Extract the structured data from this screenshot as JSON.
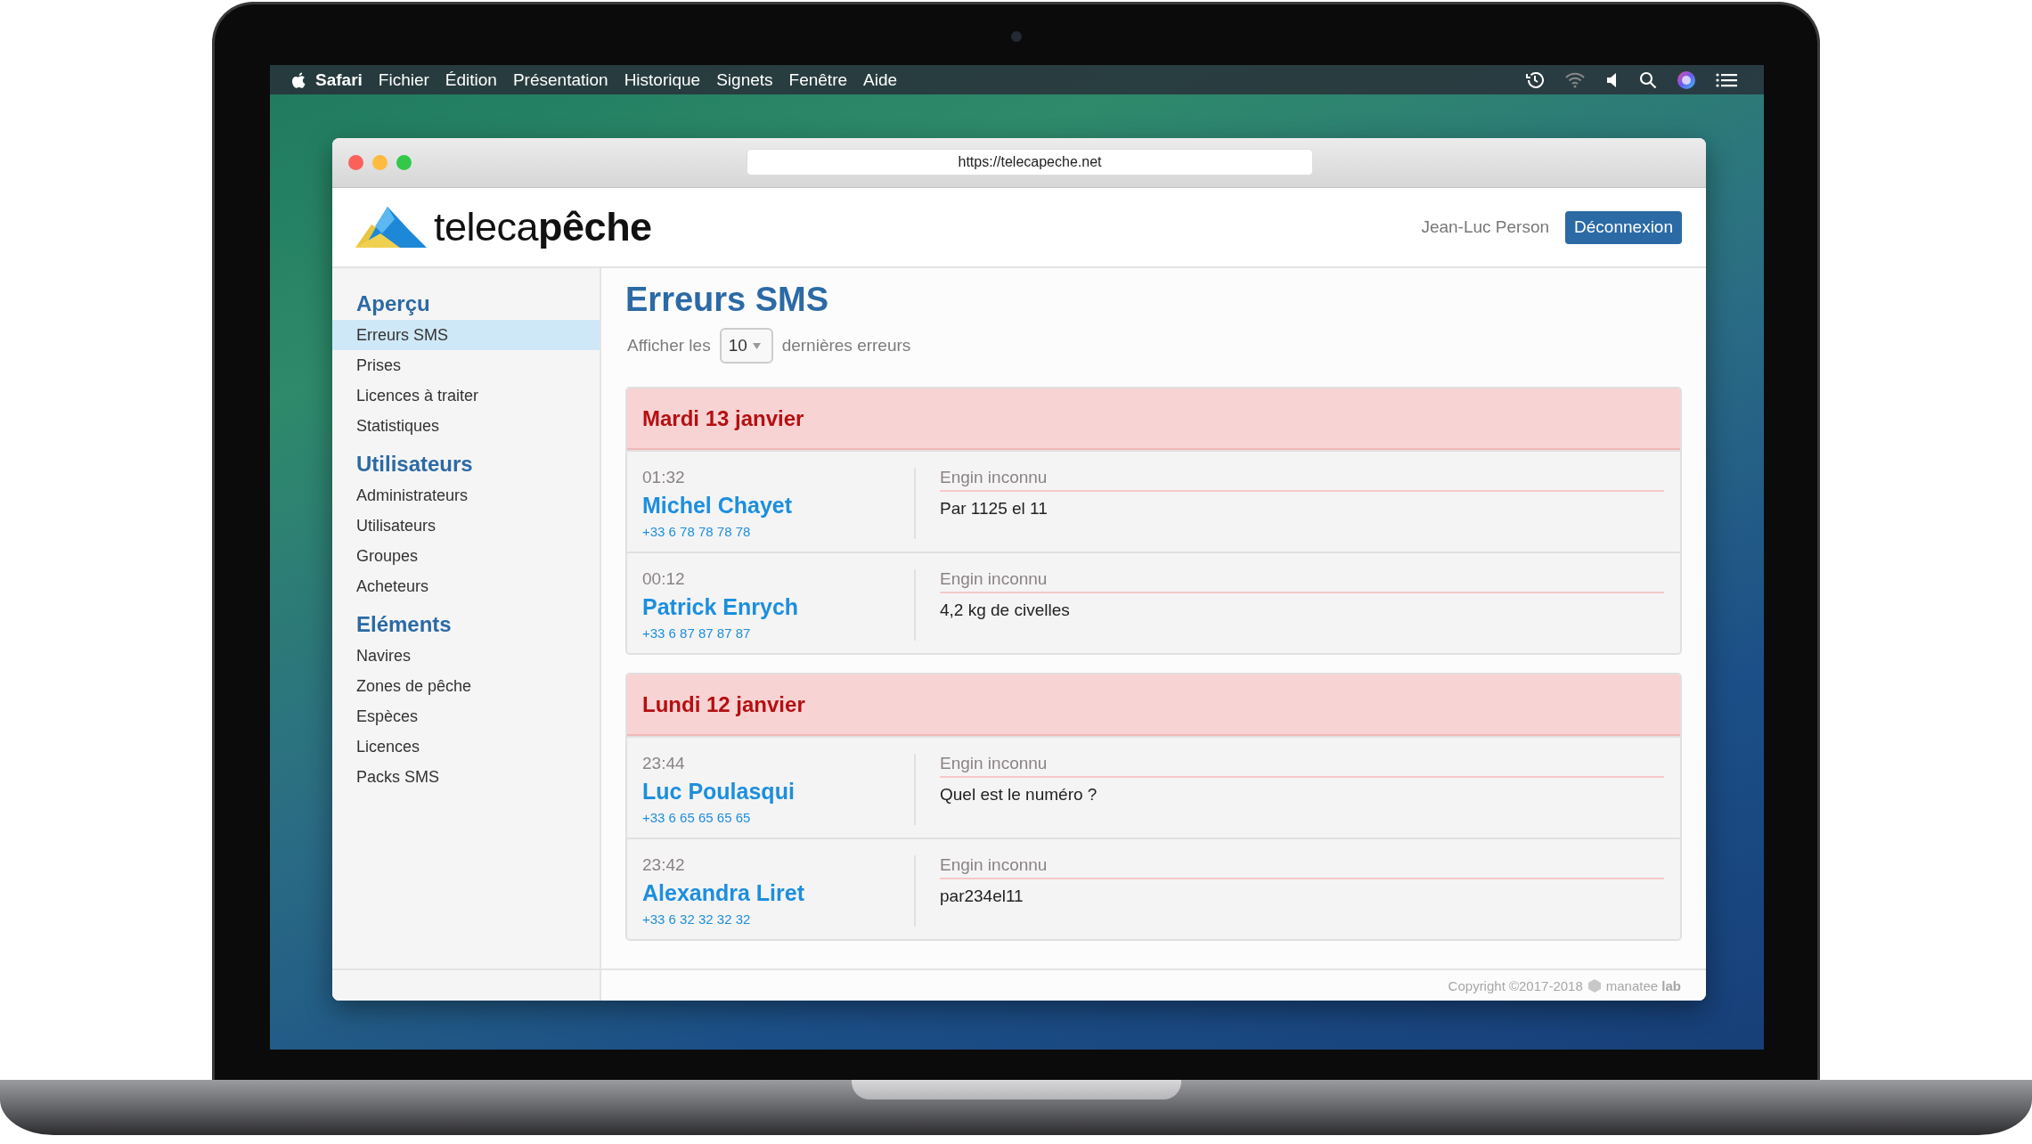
{
  "menubar": {
    "app": "Safari",
    "items": [
      "Fichier",
      "Édition",
      "Présentation",
      "Historique",
      "Signets",
      "Fenêtre",
      "Aide"
    ]
  },
  "browser": {
    "url": "https://telecapeche.net"
  },
  "header": {
    "logo_text": "teleca**pêche**",
    "user": "Jean-Luc Person",
    "logout": "Déconnexion"
  },
  "sidebar": [
    {
      "title": "Aperçu",
      "items": [
        {
          "label": "Erreurs SMS",
          "selected": true
        },
        {
          "label": "Prises",
          "selected": false
        },
        {
          "label": "Licences à traiter",
          "selected": false
        },
        {
          "label": "Statistiques",
          "selected": false
        }
      ]
    },
    {
      "title": "Utilisateurs",
      "items": [
        {
          "label": "Administrateurs",
          "selected": false
        },
        {
          "label": "Utilisateurs",
          "selected": false
        },
        {
          "label": "Groupes",
          "selected": false
        },
        {
          "label": "Acheteurs",
          "selected": false
        }
      ]
    },
    {
      "title": "Eléments",
      "items": [
        {
          "label": "Navires",
          "selected": false
        },
        {
          "label": "Zones de pêche",
          "selected": false
        },
        {
          "label": "Espèces",
          "selected": false
        },
        {
          "label": "Licences",
          "selected": false
        },
        {
          "label": "Packs SMS",
          "selected": false
        }
      ]
    }
  ],
  "page_title": "Erreurs SMS",
  "filter": {
    "prefix": "Afficher les",
    "value": "10",
    "suffix": "dernières erreurs"
  },
  "groups": [
    {
      "date": "Mardi 13 janvier",
      "entries": [
        {
          "time": "01:32",
          "name": "Michel Chayet",
          "phone": "+33 6 78 78 78 78",
          "label": "Engin inconnu",
          "message": "Par 1125 el 11"
        },
        {
          "time": "00:12",
          "name": "Patrick Enrych",
          "phone": "+33 6 87 87 87 87",
          "label": "Engin inconnu",
          "message": "4,2 kg de civelles"
        }
      ]
    },
    {
      "date": "Lundi 12 janvier",
      "entries": [
        {
          "time": "23:44",
          "name": "Luc Poulasqui",
          "phone": "+33 6 65 65 65 65",
          "label": "Engin inconnu",
          "message": "Quel est le numéro ?"
        },
        {
          "time": "23:42",
          "name": "Alexandra Liret",
          "phone": "+33 6 32 32 32 32",
          "label": "Engin inconnu",
          "message": "par234el11"
        }
      ]
    }
  ],
  "footer": {
    "copyright": "Copyright ©2017-2018",
    "brand": "manatee **lab**"
  }
}
